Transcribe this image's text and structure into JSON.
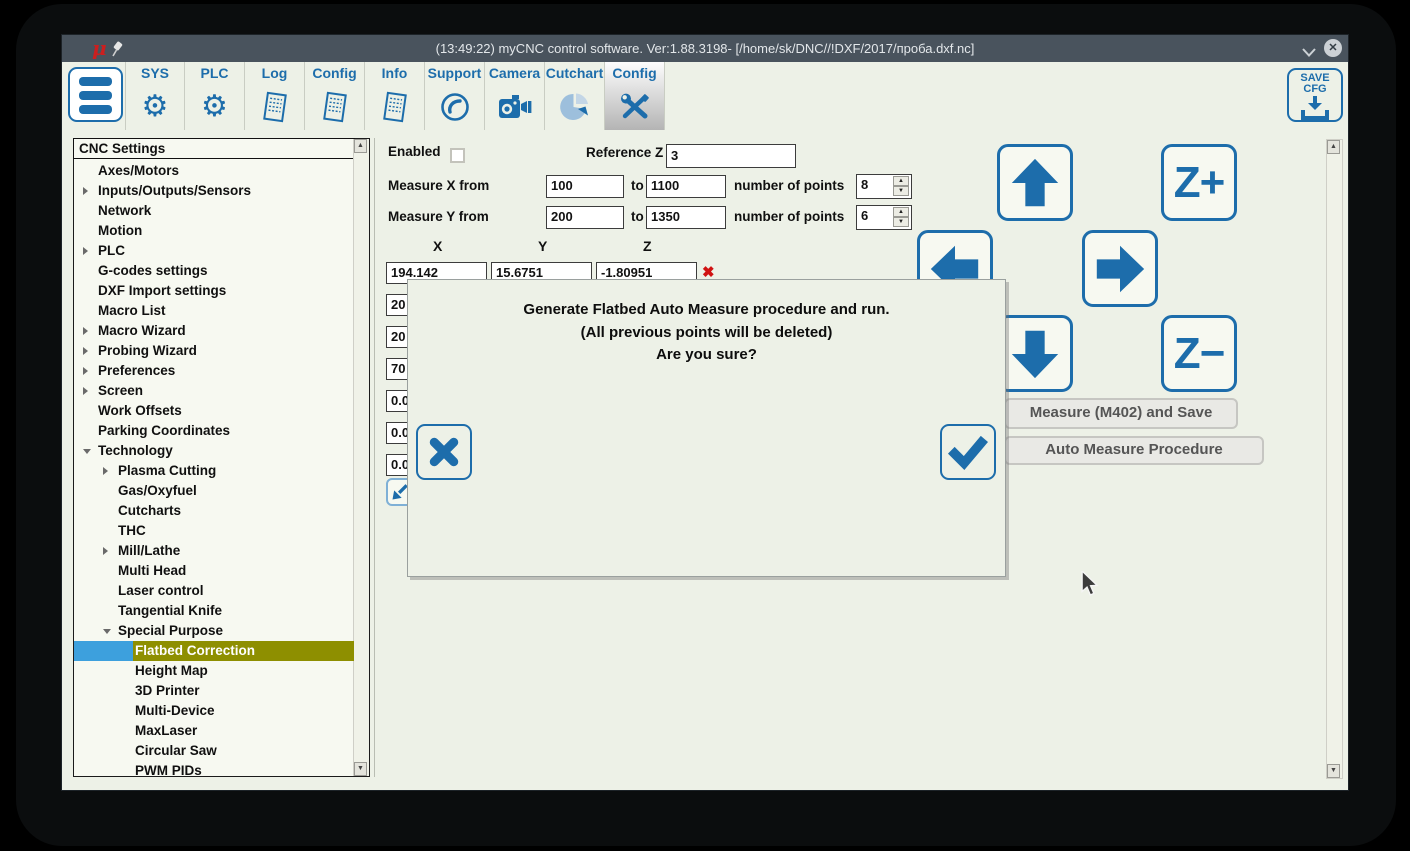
{
  "window": {
    "title": "(13:49:22) myCNC control software. Ver:1.88.3198- [/home/sk/DNC//!DXF/2017/проба.dxf.nc]",
    "logo": "μ",
    "close_glyph": "✕"
  },
  "toolbar": {
    "tabs": [
      {
        "label": "SYS",
        "icon": "gear-icon",
        "active": false
      },
      {
        "label": "PLC",
        "icon": "gear-icon",
        "active": false
      },
      {
        "label": "Log",
        "icon": "document-icon",
        "active": false
      },
      {
        "label": "Config",
        "icon": "document-icon",
        "active": false
      },
      {
        "label": "Info",
        "icon": "document-icon",
        "active": false
      },
      {
        "label": "Support",
        "icon": "phone-icon",
        "active": false
      },
      {
        "label": "Camera",
        "icon": "camera-icon",
        "active": false
      },
      {
        "label": "Cutchart",
        "icon": "piechart-icon",
        "active": false
      },
      {
        "label": "Config",
        "icon": "tools-icon",
        "active": true
      }
    ],
    "save_cfg": {
      "line1": "SAVE",
      "line2": "CFG"
    }
  },
  "sidebar": {
    "header": "CNC Settings",
    "items": [
      {
        "label": "Axes/Motors",
        "level": 1,
        "arrow": ""
      },
      {
        "label": "Inputs/Outputs/Sensors",
        "level": 1,
        "arrow": "right"
      },
      {
        "label": "Network",
        "level": 1,
        "arrow": ""
      },
      {
        "label": "Motion",
        "level": 1,
        "arrow": ""
      },
      {
        "label": "PLC",
        "level": 1,
        "arrow": "right"
      },
      {
        "label": "G-codes settings",
        "level": 1,
        "arrow": ""
      },
      {
        "label": "DXF Import settings",
        "level": 1,
        "arrow": ""
      },
      {
        "label": "Macro List",
        "level": 1,
        "arrow": ""
      },
      {
        "label": "Macro Wizard",
        "level": 1,
        "arrow": "right"
      },
      {
        "label": "Probing Wizard",
        "level": 1,
        "arrow": "right"
      },
      {
        "label": "Preferences",
        "level": 1,
        "arrow": "right"
      },
      {
        "label": "Screen",
        "level": 1,
        "arrow": "right"
      },
      {
        "label": "Work Offsets",
        "level": 1,
        "arrow": ""
      },
      {
        "label": "Parking Coordinates",
        "level": 1,
        "arrow": ""
      },
      {
        "label": "Technology",
        "level": 1,
        "arrow": "down"
      },
      {
        "label": "Plasma Cutting",
        "level": 2,
        "arrow": "right"
      },
      {
        "label": "Gas/Oxyfuel",
        "level": 2,
        "arrow": ""
      },
      {
        "label": "Cutcharts",
        "level": 2,
        "arrow": ""
      },
      {
        "label": "THC",
        "level": 2,
        "arrow": ""
      },
      {
        "label": "Mill/Lathe",
        "level": 2,
        "arrow": "right"
      },
      {
        "label": "Multi Head",
        "level": 2,
        "arrow": ""
      },
      {
        "label": "Laser control",
        "level": 2,
        "arrow": ""
      },
      {
        "label": "Tangential Knife",
        "level": 2,
        "arrow": ""
      },
      {
        "label": "Special Purpose",
        "level": 2,
        "arrow": "down"
      },
      {
        "label": "Flatbed Correction",
        "level": 3,
        "arrow": "",
        "selected": true
      },
      {
        "label": "Height Map",
        "level": 3,
        "arrow": ""
      },
      {
        "label": "3D Printer",
        "level": 3,
        "arrow": ""
      },
      {
        "label": "Multi-Device",
        "level": 3,
        "arrow": ""
      },
      {
        "label": "MaxLaser",
        "level": 3,
        "arrow": ""
      },
      {
        "label": "Circular Saw",
        "level": 3,
        "arrow": ""
      },
      {
        "label": "PWM PIDs",
        "level": 3,
        "arrow": ""
      }
    ]
  },
  "main": {
    "enabled_label": "Enabled",
    "reference_z": {
      "label": "Reference Z",
      "value": "3"
    },
    "measure_x": {
      "label": "Measure X from",
      "from": "100",
      "to_label": "to",
      "to": "1100",
      "points_label": "number of points",
      "points": "8"
    },
    "measure_y": {
      "label": "Measure Y from",
      "from": "200",
      "to_label": "to",
      "to": "1350",
      "points_label": "number of points",
      "points": "6"
    },
    "table": {
      "headers": [
        "X",
        "Y",
        "Z"
      ],
      "delete_glyph": "✖",
      "rows": [
        {
          "x": "194.142",
          "y": "15.6751",
          "z": "-1.80951"
        },
        {
          "x": "20",
          "y": "",
          "z": ""
        },
        {
          "x": "20",
          "y": "",
          "z": ""
        },
        {
          "x": "70",
          "y": "",
          "z": ""
        },
        {
          "x": "0.0",
          "y": "",
          "z": ""
        },
        {
          "x": "0.0",
          "y": "",
          "z": ""
        },
        {
          "x": "0.0",
          "y": "",
          "z": ""
        }
      ]
    },
    "jog": {
      "z_plus": "Z+",
      "z_minus": "Z−"
    },
    "buttons": {
      "measure_save": "Measure (M402) and Save",
      "auto_measure": "Auto Measure Procedure"
    }
  },
  "dialog": {
    "lines": [
      "Generate Flatbed Auto Measure procedure and run.",
      "(All previous points will be deleted)",
      "Are you sure?"
    ]
  },
  "colors": {
    "accent_blue": "#1d6dab",
    "selection_blue": "#3da0dd",
    "selection_olive": "#8e8f00",
    "titlebar": "#49535d",
    "delete_red": "#d01212",
    "panel_bg": "#edf1e7"
  }
}
